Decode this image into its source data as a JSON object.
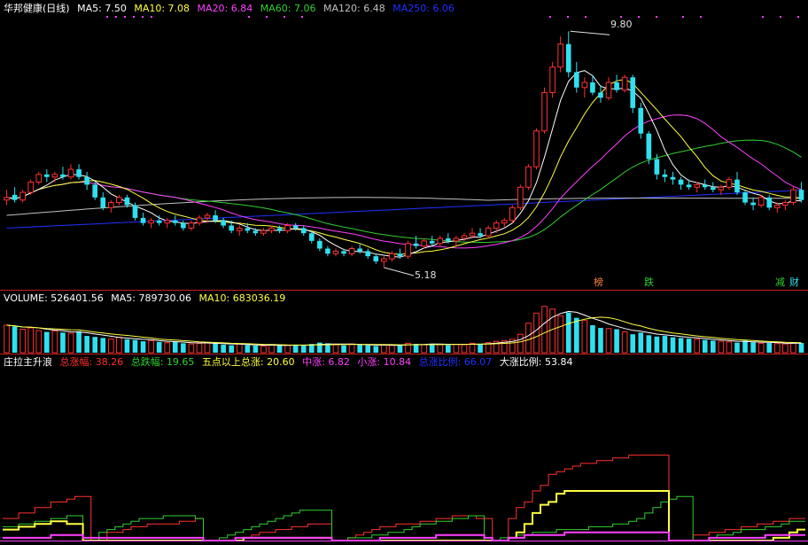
{
  "colors": {
    "background": "#000000",
    "up": "#ff3030",
    "down": "#30e0f0",
    "ma5": "#ffffff",
    "ma10": "#ffff40",
    "ma20": "#ff40ff",
    "ma60": "#30d030",
    "ma120": "#c0c0c0",
    "ma250": "#2030ff",
    "separator": "#c02020"
  },
  "price_panel": {
    "stock_name": "华邦健康",
    "period": "(日线)",
    "ma_items": [
      {
        "label": "MA5:",
        "value": "7.50",
        "color": "#ffffff"
      },
      {
        "label": "MA10:",
        "value": "7.08",
        "color": "#ffff40"
      },
      {
        "label": "MA20:",
        "value": "6.84",
        "color": "#ff40ff"
      },
      {
        "label": "MA60:",
        "value": "7.06",
        "color": "#30d030"
      },
      {
        "label": "MA120:",
        "value": "6.48",
        "color": "#c0c0c0"
      },
      {
        "label": "MA250:",
        "value": "6.06",
        "color": "#2030ff"
      }
    ],
    "high_label": "9.80",
    "low_label": "5.18",
    "event_tags": [
      {
        "text": "榜",
        "color": "#ff8040"
      },
      {
        "text": "跌",
        "color": "#30d030"
      },
      {
        "text": "减",
        "color": "#30d030"
      },
      {
        "text": "财",
        "color": "#30e0f0"
      }
    ]
  },
  "volume_panel": {
    "items": [
      {
        "label": "VOLUME:",
        "value": "526401.56",
        "color": "#ffffff"
      },
      {
        "label": "MA5:",
        "value": "789730.06",
        "color": "#ffffff"
      },
      {
        "label": "MA10:",
        "value": "683036.19",
        "color": "#ffff40"
      }
    ]
  },
  "indicator_panel": {
    "name": "庄拉主升浪",
    "items": [
      {
        "label": "总涨幅:",
        "value": "38.26",
        "color": "#ff3030"
      },
      {
        "label": "总跌幅:",
        "value": "19.65",
        "color": "#30d030"
      },
      {
        "label": "五点以上总涨:",
        "value": "20.60",
        "color": "#ffff40"
      },
      {
        "label": "中涨:",
        "value": "6.82",
        "color": "#ff40ff"
      },
      {
        "label": "小涨:",
        "value": "10.84",
        "color": "#ff40ff"
      },
      {
        "label": "总涨比例:",
        "value": "66.07",
        "color": "#2030ff"
      },
      {
        "label": "大涨比例:",
        "value": "53.84",
        "color": "#ffffff"
      }
    ]
  },
  "chart_data": {
    "type": "candlestick",
    "price_range": [
      4.9,
      10.1
    ],
    "candles": [
      [
        6.5,
        6.7,
        6.4,
        6.55
      ],
      [
        6.6,
        6.75,
        6.45,
        6.5
      ],
      [
        6.5,
        6.7,
        6.45,
        6.65
      ],
      [
        6.65,
        6.9,
        6.6,
        6.85
      ],
      [
        6.85,
        7.05,
        6.8,
        7.0
      ],
      [
        7.0,
        7.1,
        6.85,
        6.95
      ],
      [
        6.95,
        7.05,
        6.85,
        7.0
      ],
      [
        7.0,
        7.15,
        6.9,
        6.95
      ],
      [
        6.95,
        7.2,
        6.9,
        7.1
      ],
      [
        7.1,
        7.2,
        6.9,
        6.95
      ],
      [
        6.95,
        7.05,
        6.7,
        6.8
      ],
      [
        6.8,
        6.85,
        6.5,
        6.55
      ],
      [
        6.55,
        6.65,
        6.3,
        6.35
      ],
      [
        6.35,
        6.5,
        6.25,
        6.45
      ],
      [
        6.45,
        6.6,
        6.4,
        6.55
      ],
      [
        6.55,
        6.6,
        6.35,
        6.4
      ],
      [
        6.4,
        6.45,
        6.1,
        6.15
      ],
      [
        6.15,
        6.25,
        6.0,
        6.05
      ],
      [
        6.05,
        6.15,
        5.95,
        6.1
      ],
      [
        6.1,
        6.2,
        6.0,
        6.05
      ],
      [
        6.05,
        6.15,
        5.95,
        6.1
      ],
      [
        6.1,
        6.2,
        6.0,
        6.05
      ],
      [
        6.05,
        6.1,
        5.9,
        5.95
      ],
      [
        5.95,
        6.1,
        5.9,
        6.05
      ],
      [
        6.05,
        6.2,
        6.0,
        6.15
      ],
      [
        6.15,
        6.25,
        6.05,
        6.2
      ],
      [
        6.2,
        6.3,
        6.05,
        6.1
      ],
      [
        6.1,
        6.15,
        5.95,
        6.0
      ],
      [
        6.0,
        6.1,
        5.85,
        5.9
      ],
      [
        5.9,
        6.0,
        5.8,
        5.95
      ],
      [
        5.95,
        6.05,
        5.85,
        5.9
      ],
      [
        5.9,
        5.95,
        5.8,
        5.85
      ],
      [
        5.85,
        5.95,
        5.8,
        5.9
      ],
      [
        5.9,
        6.0,
        5.85,
        5.95
      ],
      [
        5.95,
        6.0,
        5.85,
        5.9
      ],
      [
        5.9,
        6.05,
        5.85,
        6.0
      ],
      [
        6.0,
        6.05,
        5.9,
        5.95
      ],
      [
        5.95,
        6.0,
        5.8,
        5.85
      ],
      [
        5.85,
        5.9,
        5.65,
        5.7
      ],
      [
        5.7,
        5.75,
        5.5,
        5.55
      ],
      [
        5.55,
        5.6,
        5.4,
        5.45
      ],
      [
        5.45,
        5.55,
        5.4,
        5.5
      ],
      [
        5.5,
        5.55,
        5.4,
        5.45
      ],
      [
        5.45,
        5.6,
        5.4,
        5.55
      ],
      [
        5.55,
        5.65,
        5.45,
        5.5
      ],
      [
        5.5,
        5.55,
        5.35,
        5.4
      ],
      [
        5.4,
        5.45,
        5.25,
        5.3
      ],
      [
        5.3,
        5.4,
        5.18,
        5.35
      ],
      [
        5.35,
        5.5,
        5.3,
        5.45
      ],
      [
        5.45,
        5.55,
        5.35,
        5.4
      ],
      [
        5.4,
        5.7,
        5.35,
        5.65
      ],
      [
        5.65,
        5.8,
        5.55,
        5.6
      ],
      [
        5.6,
        5.75,
        5.55,
        5.7
      ],
      [
        5.7,
        5.8,
        5.6,
        5.65
      ],
      [
        5.65,
        5.8,
        5.6,
        5.75
      ],
      [
        5.75,
        5.85,
        5.65,
        5.7
      ],
      [
        5.7,
        5.8,
        5.6,
        5.75
      ],
      [
        5.75,
        5.85,
        5.7,
        5.8
      ],
      [
        5.8,
        5.95,
        5.75,
        5.85
      ],
      [
        5.85,
        5.95,
        5.75,
        5.8
      ],
      [
        5.8,
        6.0,
        5.75,
        5.95
      ],
      [
        5.95,
        6.1,
        5.85,
        6.05
      ],
      [
        6.05,
        6.15,
        5.95,
        6.1
      ],
      [
        6.1,
        6.4,
        6.05,
        6.35
      ],
      [
        6.35,
        6.8,
        6.3,
        6.75
      ],
      [
        6.75,
        7.2,
        6.7,
        7.15
      ],
      [
        7.15,
        7.9,
        7.1,
        7.85
      ],
      [
        7.85,
        8.7,
        7.8,
        8.6
      ],
      [
        8.6,
        9.2,
        8.5,
        9.1
      ],
      [
        9.1,
        9.7,
        9.0,
        9.55
      ],
      [
        9.55,
        9.8,
        8.9,
        9.0
      ],
      [
        9.0,
        9.2,
        8.6,
        8.7
      ],
      [
        8.7,
        8.9,
        8.5,
        8.8
      ],
      [
        8.8,
        8.95,
        8.55,
        8.6
      ],
      [
        8.6,
        8.75,
        8.4,
        8.5
      ],
      [
        8.5,
        8.9,
        8.45,
        8.8
      ],
      [
        8.8,
        8.95,
        8.6,
        8.65
      ],
      [
        8.65,
        8.95,
        8.6,
        8.9
      ],
      [
        8.9,
        8.95,
        8.2,
        8.3
      ],
      [
        8.3,
        8.4,
        7.7,
        7.8
      ],
      [
        7.8,
        7.85,
        7.2,
        7.3
      ],
      [
        7.3,
        7.4,
        6.9,
        7.0
      ],
      [
        7.0,
        7.1,
        6.85,
        6.95
      ],
      [
        6.95,
        7.05,
        6.8,
        6.9
      ],
      [
        6.9,
        6.95,
        6.7,
        6.8
      ],
      [
        6.8,
        6.9,
        6.7,
        6.75
      ],
      [
        6.75,
        6.85,
        6.65,
        6.8
      ],
      [
        6.8,
        6.9,
        6.7,
        6.75
      ],
      [
        6.75,
        6.85,
        6.65,
        6.7
      ],
      [
        6.7,
        6.8,
        6.6,
        6.75
      ],
      [
        6.75,
        6.95,
        6.7,
        6.9
      ],
      [
        6.9,
        7.05,
        6.6,
        6.65
      ],
      [
        6.65,
        6.7,
        6.4,
        6.45
      ],
      [
        6.45,
        6.55,
        6.3,
        6.4
      ],
      [
        6.4,
        6.6,
        6.35,
        6.55
      ],
      [
        6.55,
        6.6,
        6.3,
        6.35
      ],
      [
        6.35,
        6.45,
        6.25,
        6.4
      ],
      [
        6.4,
        6.5,
        6.3,
        6.45
      ],
      [
        6.45,
        6.75,
        6.4,
        6.7
      ],
      [
        6.7,
        6.85,
        6.45,
        6.5
      ]
    ],
    "volume": [
      82,
      78,
      70,
      74,
      66,
      62,
      65,
      60,
      58,
      64,
      50,
      47,
      44,
      41,
      46,
      40,
      38,
      34,
      36,
      32,
      30,
      33,
      28,
      26,
      28,
      30,
      27,
      24,
      22,
      26,
      23,
      21,
      20,
      24,
      22,
      22,
      24,
      21,
      26,
      30,
      28,
      24,
      22,
      26,
      24,
      22,
      20,
      23,
      22,
      24,
      28,
      26,
      24,
      27,
      25,
      23,
      25,
      24,
      28,
      26,
      30,
      34,
      36,
      40,
      55,
      88,
      118,
      138,
      130,
      110,
      120,
      104,
      96,
      82,
      74,
      72,
      70,
      62,
      55,
      60,
      52,
      48,
      50,
      46,
      44,
      42,
      40,
      38,
      36,
      34,
      32,
      30,
      36,
      31,
      28,
      29,
      27,
      26,
      30,
      29
    ],
    "volume_range": [
      0,
      140
    ],
    "indicator_range": [
      0,
      45
    ],
    "indicator_series": [
      {
        "color": "#ff3030",
        "values": [
          8,
          8,
          10,
          10,
          12,
          12,
          14,
          14,
          15,
          16,
          16,
          0,
          0,
          3,
          3,
          4,
          5,
          5,
          6,
          6,
          6,
          6,
          7,
          7,
          8,
          0,
          0,
          0,
          0,
          1,
          1,
          2,
          3,
          3,
          4,
          4,
          5,
          5,
          6,
          6,
          6,
          0,
          0,
          1,
          2,
          3,
          4,
          5,
          5,
          6,
          6,
          6,
          7,
          7,
          8,
          8,
          9,
          9,
          9,
          8,
          8,
          0,
          0,
          8,
          12,
          14,
          18,
          20,
          24,
          25,
          26,
          27,
          28,
          28,
          29,
          29,
          30,
          30,
          31,
          31,
          31,
          31,
          31,
          0,
          0,
          0,
          2,
          2,
          3,
          3,
          4,
          4,
          5,
          5,
          6,
          6,
          7,
          7,
          8,
          8
        ]
      },
      {
        "color": "#30d030",
        "values": [
          5,
          5,
          6,
          6,
          7,
          7,
          8,
          8,
          9,
          9,
          0,
          0,
          3,
          4,
          5,
          6,
          7,
          8,
          8,
          8,
          9,
          9,
          9,
          9,
          8,
          0,
          0,
          1,
          2,
          3,
          4,
          5,
          6,
          7,
          8,
          9,
          10,
          11,
          11,
          11,
          11,
          0,
          0,
          1,
          1,
          1,
          2,
          2,
          3,
          3,
          4,
          5,
          6,
          6,
          7,
          7,
          8,
          8,
          9,
          9,
          0,
          0,
          1,
          1,
          2,
          2,
          3,
          3,
          3,
          4,
          4,
          4,
          4,
          5,
          5,
          5,
          6,
          6,
          7,
          8,
          10,
          12,
          14,
          15,
          16,
          16,
          0,
          0,
          1,
          2,
          2,
          3,
          4,
          4,
          4,
          5,
          5,
          6,
          7,
          7
        ]
      },
      {
        "color": "#ffff40",
        "values": [
          4,
          4,
          5,
          5,
          6,
          6,
          7,
          7,
          6,
          6,
          0,
          0,
          0,
          0,
          0,
          0,
          0,
          0,
          0,
          0,
          0,
          0,
          0,
          0,
          0,
          0,
          0,
          0,
          0,
          0,
          1,
          1,
          1,
          1,
          1,
          1,
          1,
          1,
          1,
          1,
          1,
          0,
          0,
          0,
          0,
          0,
          0,
          0,
          0,
          0,
          0,
          0,
          0,
          0,
          0,
          0,
          0,
          0,
          0,
          0,
          0,
          0,
          0,
          1,
          3,
          6,
          10,
          13,
          14,
          17,
          18,
          18,
          18,
          18,
          18,
          18,
          18,
          18,
          18,
          18,
          18,
          18,
          18,
          0,
          0,
          0,
          0,
          0,
          0,
          0,
          0,
          0,
          0,
          0,
          0,
          0,
          1,
          1,
          3,
          4
        ]
      },
      {
        "color": "#ff40ff",
        "values": [
          1,
          1,
          1,
          1,
          1,
          1,
          2,
          2,
          2,
          2,
          1,
          1,
          1,
          1,
          1,
          1,
          1,
          1,
          1,
          1,
          1,
          1,
          1,
          1,
          1,
          0,
          0,
          0,
          0,
          1,
          1,
          1,
          1,
          1,
          1,
          1,
          1,
          1,
          1,
          1,
          1,
          0,
          0,
          0,
          0,
          0,
          0,
          1,
          1,
          1,
          1,
          1,
          1,
          1,
          2,
          2,
          2,
          2,
          2,
          2,
          1,
          0,
          0,
          1,
          1,
          2,
          2,
          2,
          2,
          2,
          3,
          3,
          3,
          3,
          3,
          3,
          3,
          3,
          3,
          3,
          3,
          3,
          3,
          0,
          0,
          0,
          0,
          0,
          1,
          1,
          1,
          1,
          1,
          1,
          1,
          2,
          2,
          2,
          2,
          2
        ]
      }
    ]
  }
}
